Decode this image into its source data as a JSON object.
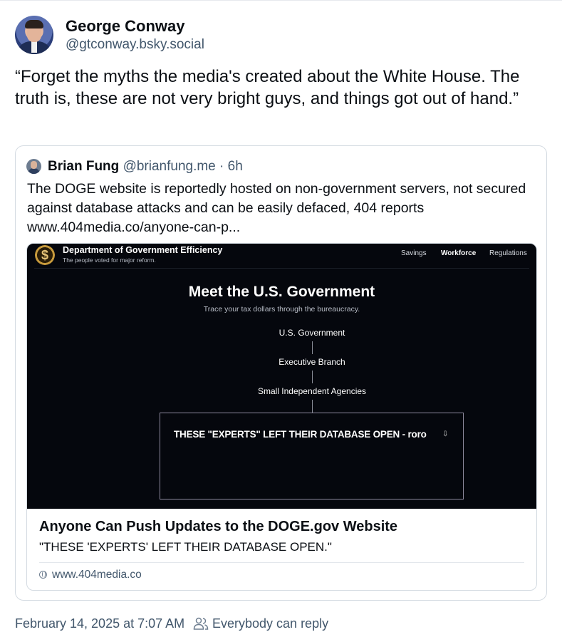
{
  "post": {
    "author_name": "George Conway",
    "author_handle": "@gtconway.bsky.social",
    "text": "“Forget the myths the media's created about the White House. The truth is, these are not very bright guys, and things got out of hand.”",
    "date": "February 14, 2025 at 7:07 AM",
    "reply_setting": "Everybody can reply"
  },
  "quote": {
    "author_name": "Brian Fung",
    "author_handle": "@brianfung.me",
    "age": "· 6h",
    "text": "The DOGE website is reportedly hosted on non-government servers, not secured against database attacks and can be easily defaced, 404 reports www.404media.co/anyone-can-p...",
    "embed": {
      "title": "Anyone Can Push Updates to the DOGE.gov Website",
      "description": "\"THESE 'EXPERTS' LEFT THEIR DATABASE OPEN.\"",
      "domain": "www.404media.co",
      "image": {
        "site_title": "Department of Government Efficiency",
        "site_tagline": "The people voted for major reform.",
        "logo_glyph": "$",
        "nav": [
          "Savings",
          "Workforce",
          "Regulations"
        ],
        "nav_active": "Workforce",
        "hero_title": "Meet the U.S. Government",
        "hero_subtitle": "Trace your tax dollars through the bureaucracy.",
        "nodes": [
          "U.S. Government",
          "Executive Branch",
          "Small Independent Agencies"
        ],
        "defaced_text": "THESE \"EXPERTS\" LEFT THEIR DATABASE OPEN - roro",
        "download_glyph": "⇩"
      }
    }
  },
  "icons": {
    "reply_setting": "people-icon",
    "domain": "globe-icon",
    "download": "download-icon"
  }
}
